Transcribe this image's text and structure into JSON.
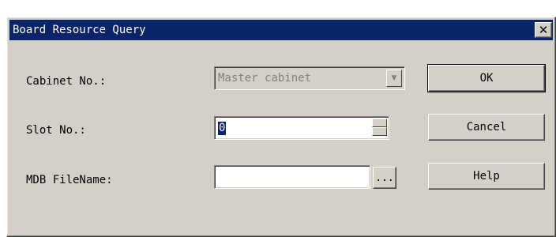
{
  "window": {
    "title": "Board Resource Query",
    "close_glyph": "✕",
    "close_icon": "close-icon"
  },
  "form": {
    "cabinet_label": "Cabinet No.:",
    "cabinet_value": "Master cabinet",
    "cabinet_disabled": true,
    "slot_label": "Slot No.:",
    "slot_value": "0",
    "mdb_label": "MDB FileName:",
    "mdb_value": "",
    "browse_label": "..."
  },
  "buttons": {
    "ok": "OK",
    "cancel": "Cancel",
    "help": "Help"
  },
  "colors": {
    "titlebar": "#0a246a",
    "face": "#d4d0c8",
    "selection": "#0a246a",
    "disabled_text": "#808080"
  }
}
